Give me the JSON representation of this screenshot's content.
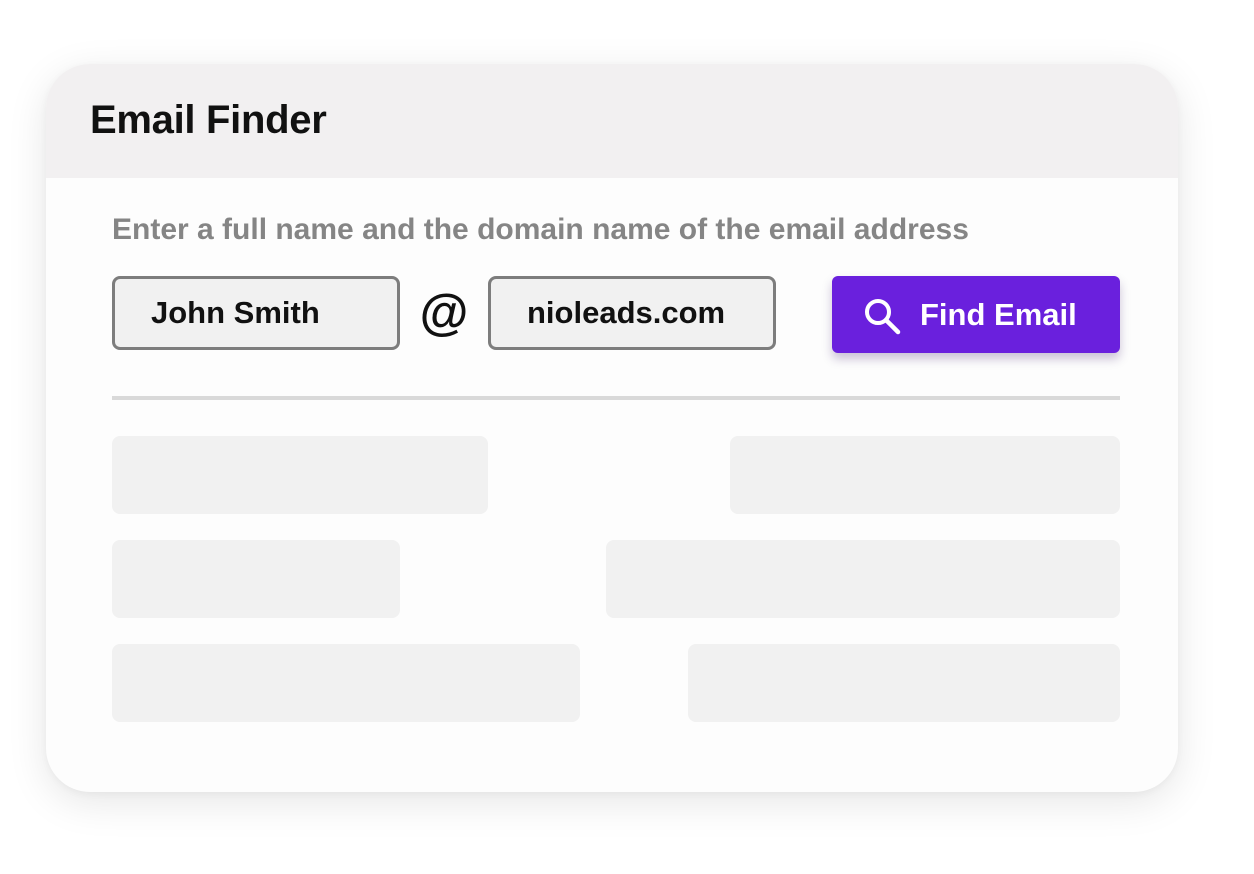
{
  "header": {
    "title": "Email Finder"
  },
  "form": {
    "instruction": "Enter a full name and the domain name of the email address",
    "name_value": "John Smith",
    "at_symbol": "@",
    "domain_value": "nioleads.com",
    "find_button_label": "Find Email",
    "find_icon": "search-icon"
  },
  "colors": {
    "accent": "#6a20dd",
    "header_bg": "#f2f0f1",
    "placeholder_block": "#f1f1f1"
  },
  "results": {
    "state": "loading-placeholders",
    "rows": 3,
    "columns": 2
  }
}
